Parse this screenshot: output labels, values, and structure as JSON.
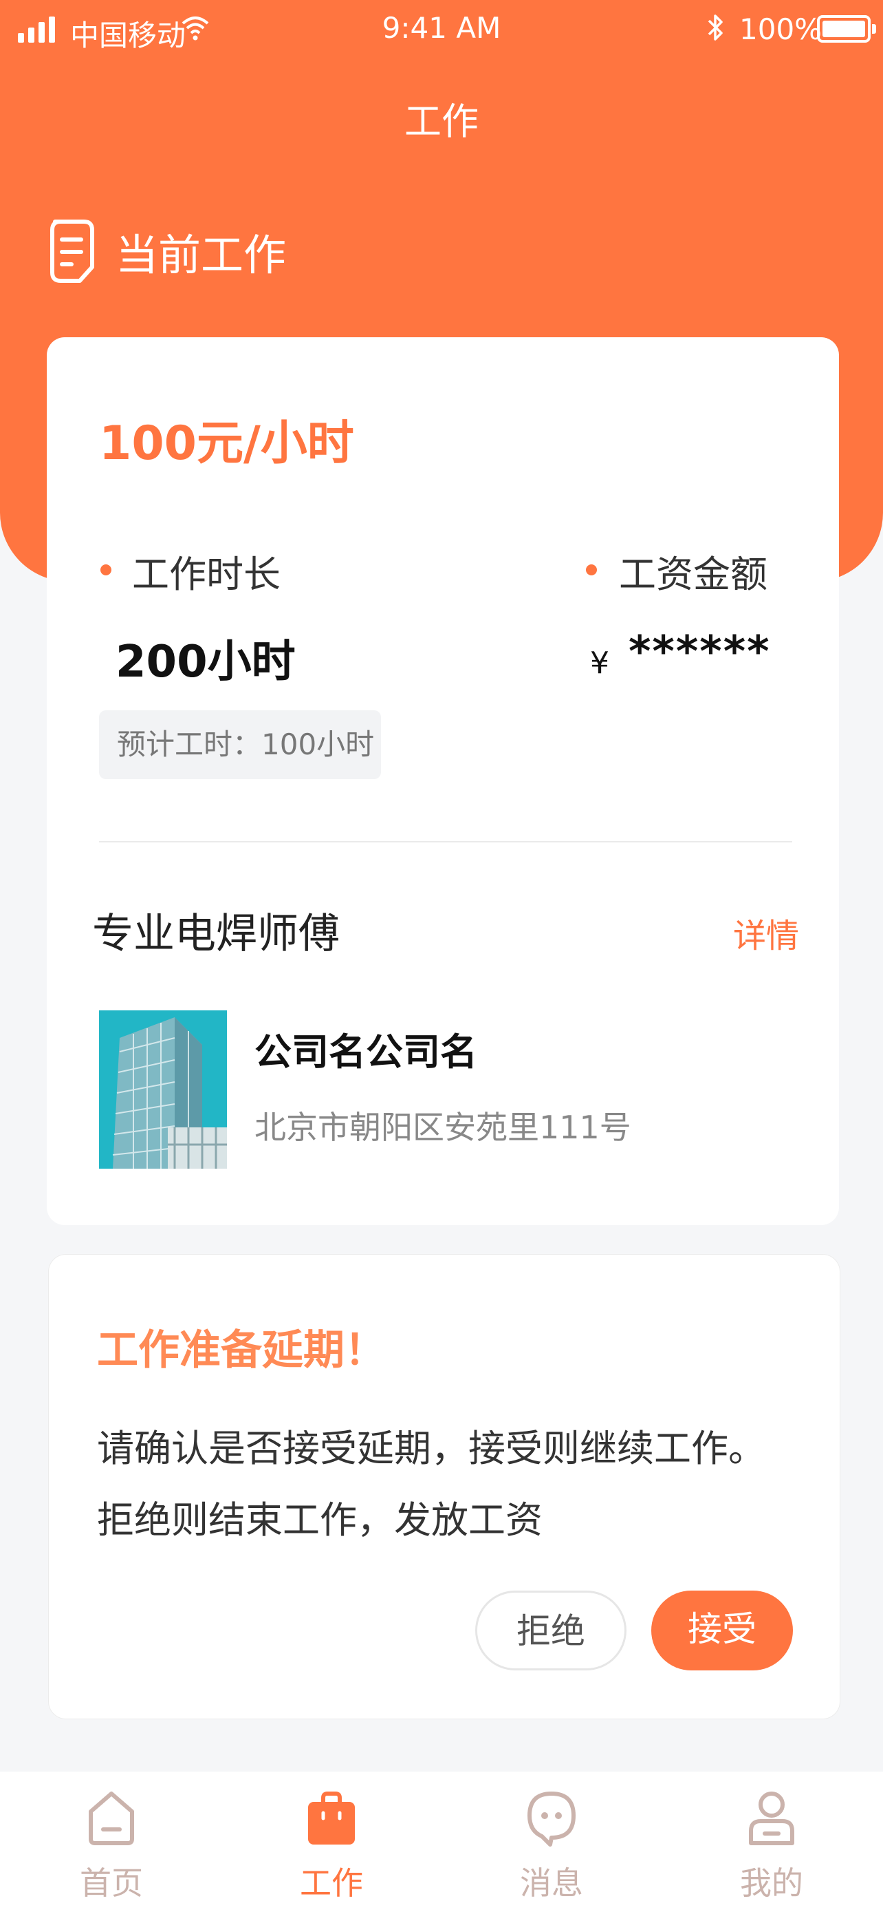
{
  "status_bar": {
    "carrier": "中国移动",
    "time": "9:41 AM",
    "battery_percent": "100%"
  },
  "nav": {
    "title": "工作"
  },
  "section": {
    "title": "当前工作",
    "icon": "document-icon"
  },
  "job": {
    "rate": "100元/小时",
    "duration_label": "工作时长",
    "duration_value": "200小时",
    "salary_label": "工资金额",
    "salary_currency": "¥",
    "salary_value": "******",
    "estimate": "预计工时：100小时",
    "title": "专业电焊师傅",
    "detail_link": "详情",
    "company_name": "公司名公司名",
    "company_address": "北京市朝阳区安苑里111号"
  },
  "delay_notice": {
    "title": "工作准备延期！",
    "body": "请确认是否接受延期，接受则继续工作。拒绝则结束工作，发放工资",
    "reject_label": "拒绝",
    "accept_label": "接受"
  },
  "tabbar": {
    "items": [
      {
        "label": "首页",
        "icon": "home-icon",
        "active": false
      },
      {
        "label": "工作",
        "icon": "briefcase-icon",
        "active": true
      },
      {
        "label": "消息",
        "icon": "chat-icon",
        "active": false
      },
      {
        "label": "我的",
        "icon": "person-icon",
        "active": false
      }
    ]
  },
  "colors": {
    "accent": "#ff7540",
    "tab_inactive": "#cbb3ac",
    "background": "#f5f6f8"
  }
}
